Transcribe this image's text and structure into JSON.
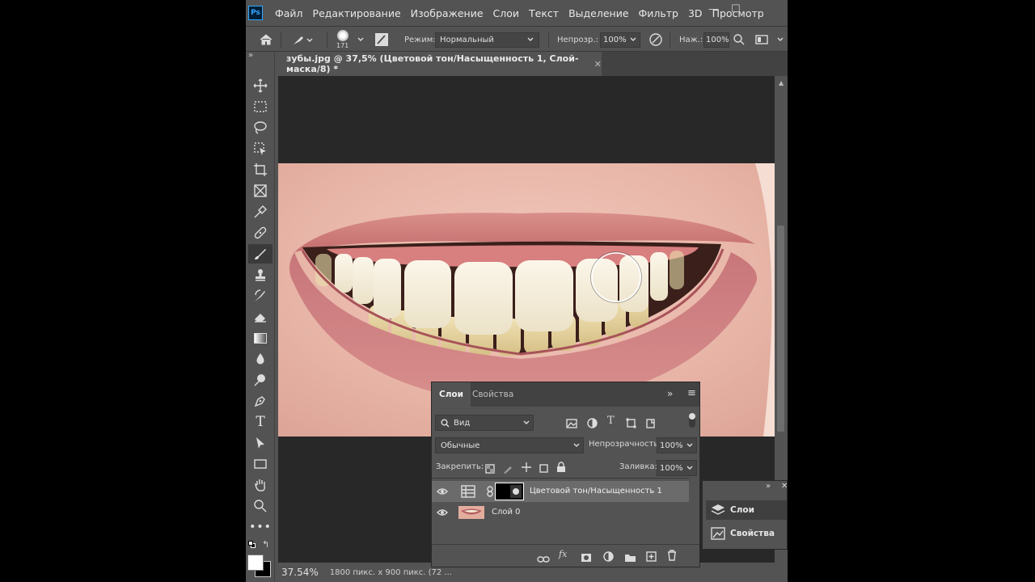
{
  "app": {
    "logo": "Ps"
  },
  "menu": [
    "Файл",
    "Редактирование",
    "Изображение",
    "Слои",
    "Текст",
    "Выделение",
    "Фильтр",
    "3D",
    "Просмотр"
  ],
  "options_bar": {
    "brush_size": "171",
    "mode_label": "Режим:",
    "mode_value": "Нормальный",
    "opacity_label": "Непрозр.:",
    "opacity_value": "100%",
    "pressure_label": "Наж.:",
    "pressure_value": "100%"
  },
  "document": {
    "tab_title": "зубы.jpg @ 37,5% (Цветовой тон/Насыщенность 1, Слой-маска/8) *",
    "zoom": "37.54%",
    "status_info": "1800 пикс. x 900 пикс. (72 ..."
  },
  "layers_panel": {
    "tabs": [
      "Слои",
      "Свойства"
    ],
    "filter_value": "Вид",
    "blend_mode": "Обычные",
    "opacity_label": "Непрозрачность:",
    "opacity_value": "100%",
    "lock_label": "Закрепить:",
    "fill_label": "Заливка:",
    "fill_value": "100%",
    "layers": [
      {
        "name": "Цветовой тон/Насыщенность 1",
        "visible": true,
        "selected": true,
        "type": "adjustment-hue-saturation"
      },
      {
        "name": "Слой 0",
        "visible": true,
        "selected": false,
        "type": "pixel"
      }
    ],
    "footer_icons": [
      "link-icon",
      "fx-icon",
      "mask-icon",
      "adjustment-icon",
      "folder-icon",
      "new-layer-icon",
      "trash-icon"
    ]
  },
  "mini_panel": {
    "items": [
      "Слои",
      "Свойства"
    ]
  },
  "colors": {
    "ui_bg": "#535353",
    "canvas_bg": "#282828",
    "accent": "#31a8ff"
  }
}
